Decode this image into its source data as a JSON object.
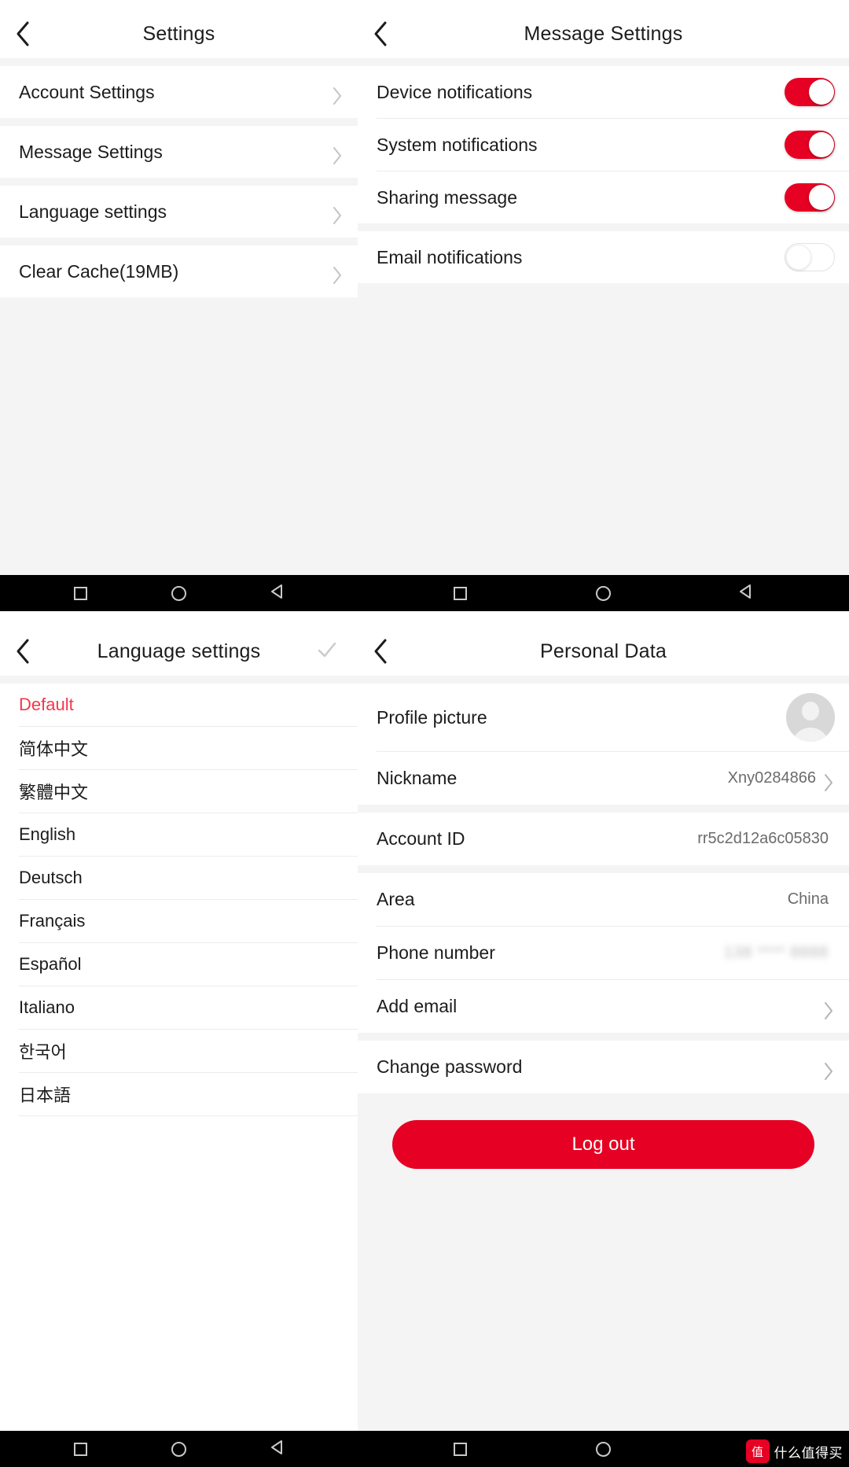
{
  "accent": {
    "red": "#e60023",
    "red_text": "#f4364c",
    "chevron_gray": "#c4c4c4",
    "divider": "#ececec",
    "page_bg": "#f4f4f4"
  },
  "panel_settings": {
    "header": {
      "title": "Settings",
      "back_icon": "chevron-left-icon"
    },
    "rows": [
      {
        "label": "Account Settings",
        "chevron": "chevron-right-icon"
      },
      {
        "label": "Message Settings",
        "chevron": "chevron-right-icon"
      },
      {
        "label": "Language settings",
        "chevron": "chevron-right-icon"
      },
      {
        "label": "Clear Cache(19MB)",
        "chevron": "chevron-right-icon"
      }
    ]
  },
  "panel_message_settings": {
    "header": {
      "title": "Message Settings",
      "back_icon": "chevron-left-icon"
    },
    "rows": [
      {
        "label": "Device notifications",
        "state": "on"
      },
      {
        "label": "System notifications",
        "state": "on"
      },
      {
        "label": "Sharing message",
        "state": "on"
      },
      {
        "label": "Email notifications",
        "state": "off"
      }
    ]
  },
  "panel_language_settings": {
    "header": {
      "title": "Language settings",
      "back_icon": "chevron-left-icon",
      "confirm_icon": "check-icon"
    },
    "items": [
      {
        "label": "Default",
        "selected": true
      },
      {
        "label": "简体中文",
        "selected": false
      },
      {
        "label": "繁體中文",
        "selected": false
      },
      {
        "label": "English",
        "selected": false
      },
      {
        "label": "Deutsch",
        "selected": false
      },
      {
        "label": "Français",
        "selected": false
      },
      {
        "label": "Español",
        "selected": false
      },
      {
        "label": "Italiano",
        "selected": false
      },
      {
        "label": "한국어",
        "selected": false
      },
      {
        "label": "日本語",
        "selected": false
      }
    ]
  },
  "panel_personal_data": {
    "header": {
      "title": "Personal Data",
      "back_icon": "chevron-left-icon"
    },
    "rows": [
      {
        "label": "Profile picture",
        "kind": "avatar",
        "value": ""
      },
      {
        "label": "Nickname",
        "kind": "value-chevron",
        "value": "Xny0284866"
      },
      {
        "label": "Account ID",
        "kind": "value",
        "value": "rr5c2d12a6c05830"
      },
      {
        "label": "Area",
        "kind": "value",
        "value": "China"
      },
      {
        "label": "Phone number",
        "kind": "blurred",
        "value": "138 **** 8888"
      },
      {
        "label": "Add email",
        "kind": "chevron",
        "value": ""
      },
      {
        "label": "Change password",
        "kind": "chevron",
        "value": ""
      }
    ],
    "logout_label": "Log out"
  },
  "android_nav": {
    "recents_icon": "square-icon",
    "home_icon": "circle-icon",
    "back_icon": "triangle-back-icon"
  },
  "watermark": {
    "badge": "值",
    "text": "什么值得买"
  }
}
